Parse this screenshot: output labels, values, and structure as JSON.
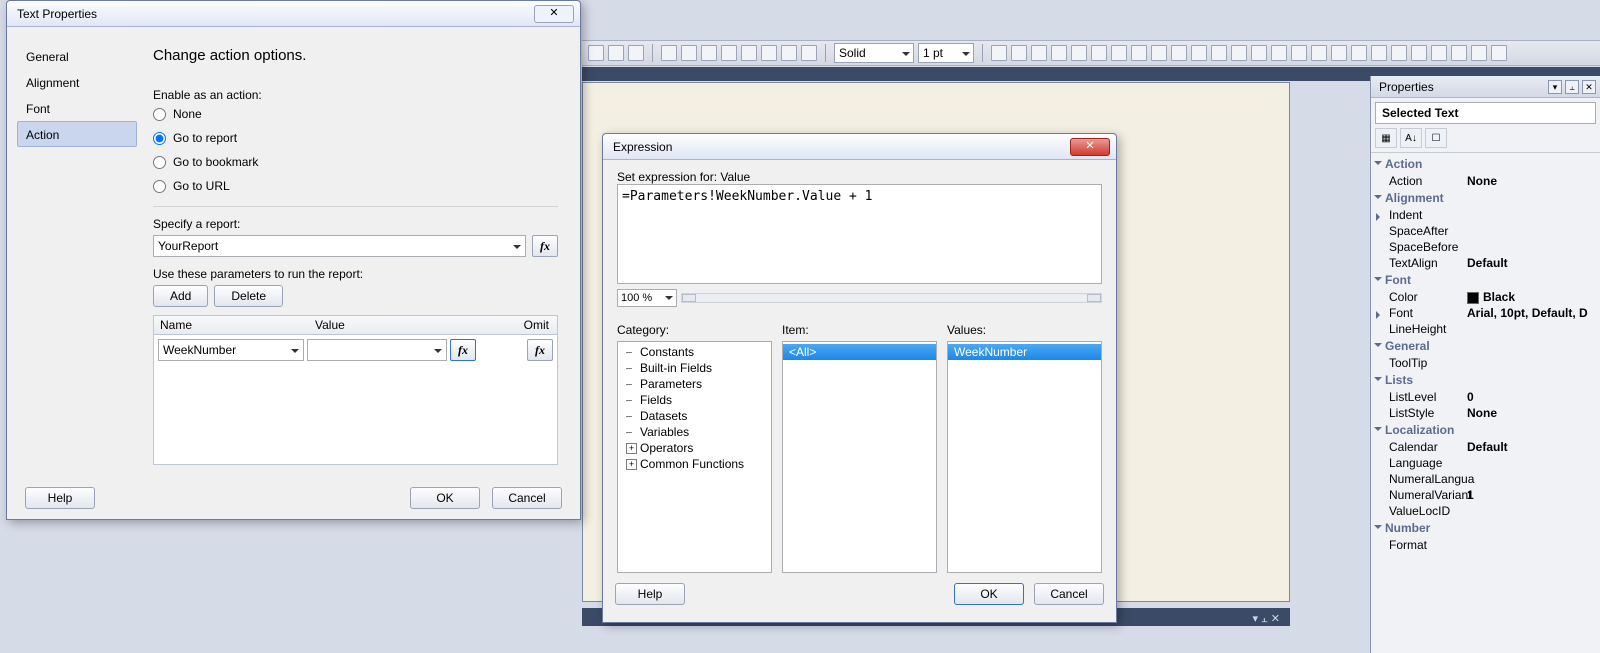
{
  "toolbar": {
    "borderStyle": "Solid",
    "borderWidth": "1 pt"
  },
  "textProperties": {
    "title": "Text Properties",
    "nav": {
      "general": "General",
      "alignment": "Alignment",
      "font": "Font",
      "action": "Action"
    },
    "heading": "Change action options.",
    "enableLabel": "Enable as an action:",
    "radios": {
      "none": "None",
      "report": "Go to report",
      "bookmark": "Go to bookmark",
      "url": "Go to URL"
    },
    "specifyReport": "Specify a report:",
    "reportValue": "YourReport",
    "paramsHint": "Use these parameters to run the report:",
    "add": "Add",
    "delete": "Delete",
    "cols": {
      "name": "Name",
      "value": "Value",
      "omit": "Omit"
    },
    "paramName": "WeekNumber",
    "help": "Help",
    "ok": "OK",
    "cancel": "Cancel",
    "fx": "fx"
  },
  "expression": {
    "title": "Expression",
    "setFor": "Set expression for: Value",
    "code": "=Parameters!WeekNumber.Value + 1",
    "zoom": "100 %",
    "catLabel": "Category:",
    "itemLabel": "Item:",
    "valLabel": "Values:",
    "categories": [
      "Constants",
      "Built-in Fields",
      "Parameters",
      "Fields",
      "Datasets",
      "Variables",
      "Operators",
      "Common Functions"
    ],
    "itemAll": "<All>",
    "valueSel": "WeekNumber",
    "help": "Help",
    "ok": "OK",
    "cancel": "Cancel"
  },
  "properties": {
    "title": "Properties",
    "object": "Selected Text",
    "groups": {
      "action": "Action",
      "alignment": "Alignment",
      "font": "Font",
      "general": "General",
      "lists": "Lists",
      "localization": "Localization",
      "number": "Number"
    },
    "rows": {
      "Action": "None",
      "Indent": "",
      "SpaceAfter": "",
      "SpaceBefore": "",
      "TextAlign": "Default",
      "Color": "Black",
      "Font": "Arial, 10pt, Default, D",
      "LineHeight": "",
      "ToolTip": "",
      "ListLevel": "0",
      "ListStyle": "None",
      "Calendar": "Default",
      "Language": "",
      "NumeralLangua": "",
      "NumeralVariant": "1",
      "ValueLocID": "",
      "Format": ""
    }
  }
}
